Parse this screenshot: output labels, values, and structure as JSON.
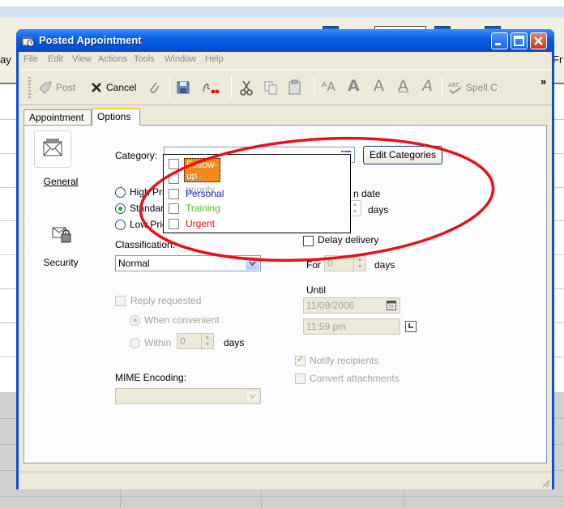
{
  "background": {
    "day_left": "ay",
    "day_right": "Fr"
  },
  "window": {
    "title": "Posted Appointment",
    "title_icon": "appointment-icon",
    "controls": [
      "minimize",
      "maximize",
      "close"
    ]
  },
  "menu": [
    "File",
    "Edit",
    "View",
    "Actions",
    "Tools",
    "Window",
    "Help"
  ],
  "toolbar": {
    "post": "Post",
    "cancel": "Cancel",
    "spell": "Spell C",
    "overflow": "»",
    "format_a": [
      "A",
      "A",
      "A",
      "A"
    ]
  },
  "tabs": [
    {
      "label": "Appointment",
      "active": false
    },
    {
      "label": "Options",
      "active": true
    }
  ],
  "nav": {
    "general": "General",
    "security": "Security"
  },
  "category": {
    "label": "Category:",
    "edit_button": "Edit Categories",
    "options": [
      {
        "label": "Follow-up",
        "color": "#ffffff",
        "selected": true
      },
      {
        "label": "Low priority",
        "color": "#a4a49a",
        "selected": false
      },
      {
        "label": "Personal",
        "color": "#1a1acc",
        "selected": false
      },
      {
        "label": "Training",
        "color": "#4fc21e",
        "selected": false
      },
      {
        "label": "Urgent",
        "color": "#e01010",
        "selected": false
      }
    ]
  },
  "priority": {
    "high": "High Prio",
    "standard": "Standard",
    "low": "Low Prio"
  },
  "classification": {
    "label": "Classification:",
    "value": "Normal"
  },
  "reply": {
    "label": "Reply requested",
    "when_convenient": "When convenient",
    "within": "Within",
    "within_value": "0",
    "days": "days"
  },
  "mime": {
    "label": "MIME Encoding:"
  },
  "right": {
    "expiry_label": "n date",
    "expiry_days": "days",
    "delay": "Delay delivery",
    "for": "For",
    "for_value": "0",
    "for_days": "days",
    "until": "Until",
    "until_date": "11/09/2006",
    "until_time": "11:59 pm",
    "notify": "Notify recipients",
    "convert": "Convert attachments"
  }
}
